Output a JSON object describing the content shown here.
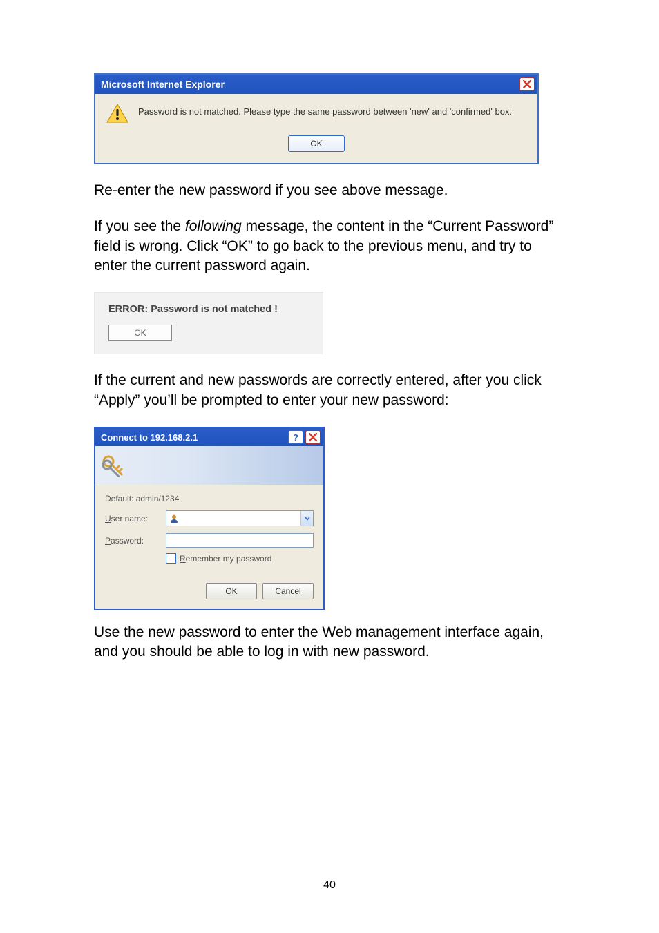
{
  "dialog1": {
    "title": "Microsoft Internet Explorer",
    "message": "Password is not matched. Please type the same password between 'new' and 'confirmed' box.",
    "ok": "OK"
  },
  "para1": "Re-enter the new password if you see above message.",
  "para2_a": "If you see the ",
  "para2_b": "following",
  "para2_c": " message, the content in the “Current Password” field is wrong. Click “OK” to go back to the previous menu, and try to enter the current password again.",
  "dialog2": {
    "title": "ERROR: Password is not matched !",
    "ok": "OK"
  },
  "para3": "If the current and new passwords are correctly entered, after you click “Apply” you’ll be prompted to enter your new password:",
  "dialog3": {
    "title": "Connect to 192.168.2.1",
    "realm": "Default: admin/1234",
    "userLabel_u": "U",
    "userLabel_rest": "ser name:",
    "passLabel_u": "P",
    "passLabel_rest": "assword:",
    "remember_u": "R",
    "remember_rest": "emember my password",
    "ok": "OK",
    "cancel": "Cancel",
    "help": "?"
  },
  "para4": "Use the new password to enter the Web management interface again, and you should be able to log in with new password.",
  "pageNumber": "40"
}
